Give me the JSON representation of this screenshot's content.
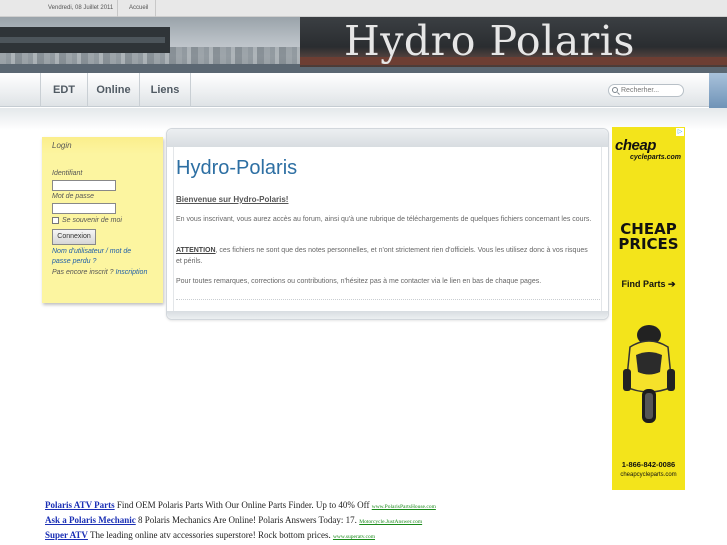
{
  "topbar": {
    "date": "Vendredi, 08 Juillet 2011",
    "home": "Accueil"
  },
  "banner": {
    "title": "Hydro Polaris"
  },
  "nav": {
    "items": [
      "EDT",
      "Online",
      "Liens"
    ],
    "search_placeholder": "Recherher..."
  },
  "login": {
    "title": "Login",
    "username_label": "Identifiant",
    "password_label": "Mot de passe",
    "remember_label": "Se souvenir de moi",
    "submit_label": "Connexion",
    "forgot_link": "Nom d'utilisateur / mot de passe perdu ?",
    "register_text": "Pas encore inscrit ?",
    "register_link": "Inscription"
  },
  "article": {
    "title": "Hydro-Polaris",
    "welcome": "Bienvenue sur Hydro-Polaris!",
    "p1": "En vous inscrivant, vous aurez accès au forum, ainsi qu'à une rubrique de téléchargements de quelques fichiers concernant les cours.",
    "attention": "ATTENTION",
    "p2": ", ces fichiers ne sont que des notes personnelles, et n'ont strictement rien d'officiels. Vous les utilisez donc à vos risques et périls.",
    "p3": "Pour toutes remarques, corrections ou contributions, n'hésitez pas à me contacter via le lien en bas de chaque pages."
  },
  "side_ad": {
    "logo": "cheap",
    "logo_sub": "cycleparts.com",
    "headline": [
      "CHEAP",
      "PRICES"
    ],
    "cta": "Find Parts ➔",
    "phone": "1-866-842-0086",
    "site": "cheapcycleparts.com",
    "colors": {
      "background": "#f3e41b",
      "text": "#111111"
    }
  },
  "ad_links": [
    {
      "title": "Polaris ATV Parts",
      "text": " Find OEM Polaris Parts With Our Online Parts Finder. Up to 40% Off ",
      "url": "www.PolarisPartsHouse.com"
    },
    {
      "title": "Ask a Polaris Mechanic",
      "text": " 8 Polaris Mechanics Are Online! Polaris Answers Today: 17. ",
      "url": "Motorcycle.JustAnswer.com"
    },
    {
      "title": "Super ATV",
      "text": " The leading online atv accessories superstore! Rock bottom prices. ",
      "url": "www.superatv.com"
    }
  ]
}
